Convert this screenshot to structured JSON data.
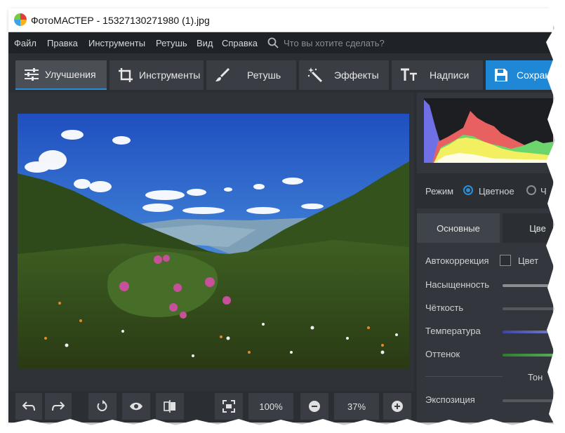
{
  "window": {
    "title": "ФотоМАСТЕР - 15327130271980 (1).jpg"
  },
  "menu": {
    "items": [
      "Файл",
      "Правка",
      "Инструменты",
      "Ретушь",
      "Вид",
      "Справка"
    ],
    "search_placeholder": "Что вы хотите сделать?"
  },
  "tabs": [
    {
      "label": "Улучшения",
      "icon": "sliders-icon",
      "active": true
    },
    {
      "label": "Инструменты",
      "icon": "crop-icon",
      "active": false
    },
    {
      "label": "Ретушь",
      "icon": "brush-icon",
      "active": false
    },
    {
      "label": "Эффекты",
      "icon": "magic-wand-icon",
      "active": false
    },
    {
      "label": "Надписи",
      "icon": "text-icon",
      "active": false
    },
    {
      "label": "Сохран",
      "icon": "save-icon",
      "active": false
    }
  ],
  "panel": {
    "mode_label": "Режим",
    "mode_options": [
      "Цветное",
      "Ч"
    ],
    "mode_selected": "Цветное",
    "subtabs": [
      "Основные",
      "Цве"
    ],
    "autocorrection_label": "Автокоррекция",
    "color_checkbox_label": "Цвет",
    "properties": [
      {
        "label": "Насыщенность",
        "color": "#8a8e93"
      },
      {
        "label": "Чёткость",
        "color": "#55595e"
      },
      {
        "label": "Температура",
        "color": "#5a5fb0"
      },
      {
        "label": "Оттенок",
        "color": "#4a9a4a"
      }
    ],
    "tone_label": "Тон",
    "exposure_label": "Экспозиция"
  },
  "bottom": {
    "zoom_fit_label": "100%",
    "zoom_value": "37%"
  },
  "colors": {
    "accent": "#2a8fd6",
    "save_button": "#1e88d7"
  }
}
